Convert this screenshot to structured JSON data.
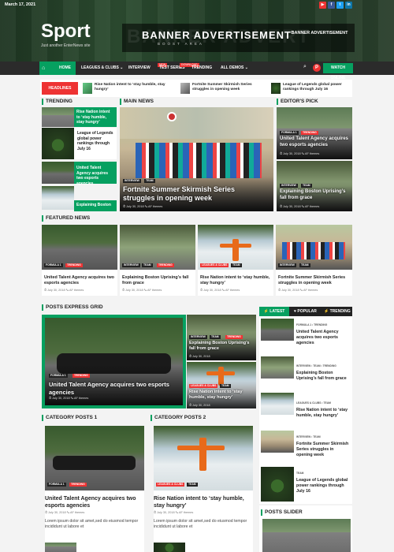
{
  "topbar": {
    "date": "March 17, 2021"
  },
  "site": {
    "title": "Sport",
    "tagline": "Just another EnterNews site"
  },
  "banner": {
    "bg_text": "BANNER ADVERT",
    "title": "BANNER ADVERTISEMENT",
    "subtitle": "BOOST AREA",
    "side": "BANNER ADVERTISEMENT"
  },
  "nav": {
    "items": [
      "HOME",
      "LEAGUES & CLUBS ⌄",
      "INTERVIEW",
      "TEST SERIES",
      "TRENDING",
      "ALL DEMOS ⌄"
    ],
    "tags": [
      "NEW",
      "DOWNLOAD"
    ],
    "watch": "WATCH ONLINE",
    "pin": "P"
  },
  "ticker": {
    "label": "HEADLINES",
    "items": [
      "Rise Nation intent to ‘stay humble, stay hungry’",
      "Fortnite Summer Skirmish Series struggles in opening week",
      "League of Legends global power rankings through July 16"
    ]
  },
  "sections": {
    "trending": "TRENDING",
    "main_news": "MAIN NEWS",
    "editors_pick": "EDITOR'S PICK",
    "featured": "FEATURED NEWS",
    "express": "POSTS EXPRESS GRID",
    "cat1": "CATEGORY POSTS 1",
    "cat2": "CATEGORY POSTS 2",
    "slider": "POSTS SLIDER"
  },
  "trending": [
    "Rise Nation intent to ‘stay humble, stay hungry’",
    "League of Legends global power rankings through July 16",
    "United Talent Agency acquires two esports agencies",
    "Explaining Boston"
  ],
  "main_news": {
    "tags": [
      "INTERVIEW",
      "TEAM"
    ],
    "title": "Fortnite Summer Skirmish Series struggles in opening week",
    "meta": "⏱ July 30, 2018   ✎ AF themes"
  },
  "editors_pick": [
    {
      "tags": [
        "FORMULA 1",
        "TRENDING"
      ],
      "title": "United Talent Agency acquires two esports agencies",
      "meta": "⏱ July 30, 2018  ✎ AF themes"
    },
    {
      "tags": [
        "INTERVIEW",
        "TEAM"
      ],
      "title": "Explaining Boston Uprising’s fall from grace",
      "meta": "⏱ July 30, 2018  ✎ AF themes"
    }
  ],
  "featured": [
    {
      "tags": [
        "FORMULA 1",
        "TRENDING"
      ],
      "title": "United Talent Agency acquires two esports agencies",
      "meta": "⏱ July 30, 2018   ✎ AF themes"
    },
    {
      "tags": [
        "INTERVIEW",
        "TEAM",
        "TRENDING"
      ],
      "title": "Explaining Boston Uprising’s fall from grace",
      "meta": "⏱ July 30, 2018   ✎ AF themes"
    },
    {
      "tags": [
        "LEAGUES & CLUBS",
        "TEAM"
      ],
      "title": "Rise Nation intent to ‘stay humble, stay hungry’",
      "meta": "⏱ July 30, 2018   ✎ AF themes"
    },
    {
      "tags": [
        "INTERVIEW",
        "TEAM"
      ],
      "title": "Fortnite Summer Skirmish Series struggles in opening week",
      "meta": "⏱ July 30, 2018   ✎ AF themes"
    }
  ],
  "express": {
    "big": {
      "tags": [
        "FORMULA 1",
        "TRENDING"
      ],
      "title": "United Talent Agency acquires two esports agencies",
      "meta": "⏱ July 30, 2018   ✎ AF themes"
    },
    "small": [
      {
        "tags": [
          "INTERVIEW",
          "TEAM",
          "TRENDING"
        ],
        "title": "Explaining Boston Uprising’s fall from grace",
        "meta": "⏱ July 30, 2018"
      },
      {
        "tags": [
          "LEAGUES & CLUBS",
          "TEAM"
        ],
        "title": "Rise Nation intent to ‘stay humble, stay hungry’",
        "meta": "⏱ July 30, 2018"
      }
    ]
  },
  "tabs": {
    "latest": "⚡ LATEST",
    "popular": "♥ POPULAR",
    "trending": "⚡ TRENDING"
  },
  "sidebar_list": [
    {
      "tags": "FORMULA 1  •  TRENDING",
      "title": "United Talent Agency acquires two esports agencies"
    },
    {
      "tags": "INTERVIEW  •  TEAM  •  TRENDING",
      "title": "Explaining Boston Uprising’s fall from grace"
    },
    {
      "tags": "LEAGUES & CLUBS  •  TEAM",
      "title": "Rise Nation intent to ‘stay humble, stay hungry’"
    },
    {
      "tags": "INTERVIEW  •  TEAM",
      "title": "Fortnite Summer Skirmish Series struggles in opening week"
    },
    {
      "tags": "TEAM",
      "title": "League of Legends global power rankings through July 16"
    }
  ],
  "cat1": {
    "tags": [
      "FORMULA 1",
      "TRENDING"
    ],
    "title": "United Talent Agency acquires two esports agencies",
    "meta": "⏱ July 30, 2018   ✎ AF themes",
    "excerpt": "Lorem ipsum dolor sit amet,sed do eiusmod tempor incididunt ut labore et"
  },
  "cat2": {
    "tags": [
      "LEAGUES & CLUBS",
      "TEAM"
    ],
    "title": "Rise Nation intent to ‘stay humble, stay hungry’",
    "meta": "⏱ July 30, 2018   ✎ AF themes",
    "excerpt": "Lorem ipsum dolor sit amet,sed do eiusmod tempor incididunt ut labore et"
  },
  "colors": {
    "accent": "#06a060",
    "red": "#e33",
    "dark": "#222"
  }
}
